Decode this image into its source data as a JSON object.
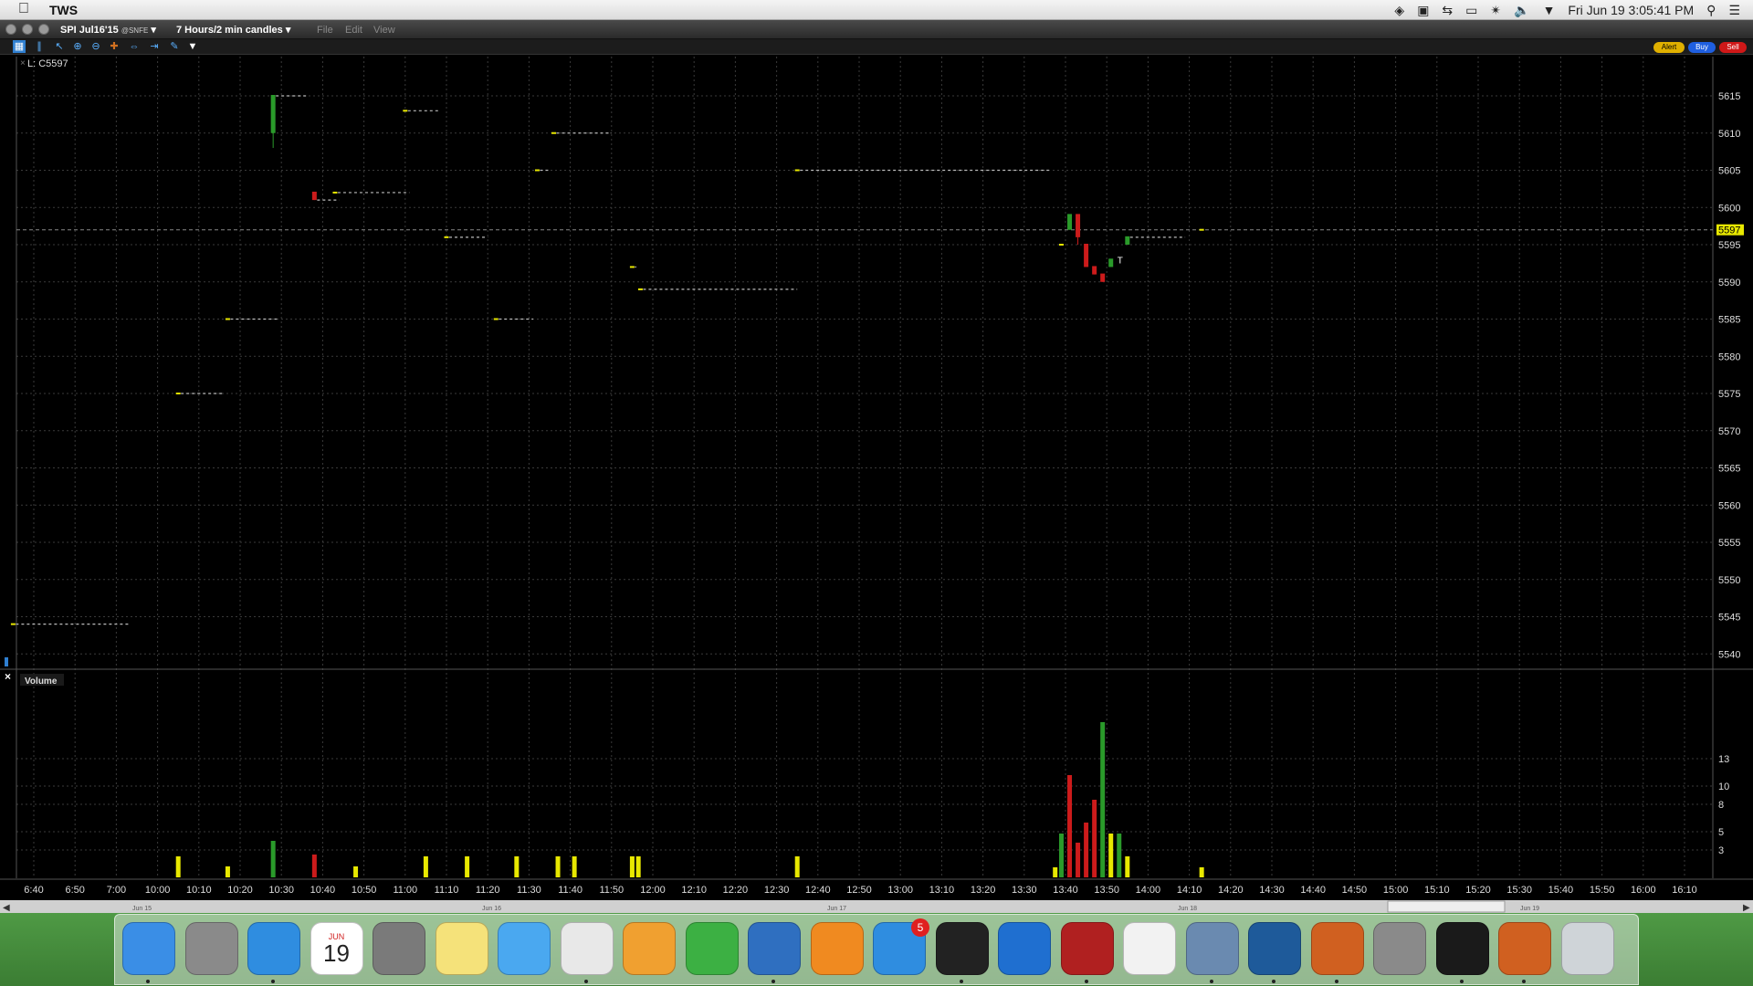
{
  "menubar": {
    "app_name": "TWS",
    "clock": "Fri Jun 19  3:05:41 PM",
    "tray_icons": [
      "dropbox-icon",
      "screenshot-icon",
      "teamviewer-icon",
      "airplay-icon",
      "bluetooth-icon",
      "volume-icon",
      "wifi-icon",
      "clock",
      "spotlight-icon",
      "notification-center-icon"
    ]
  },
  "window": {
    "symbol": "SPI Jul16'15",
    "exchange": "@SNFE",
    "period": "7 Hours/2 min candles",
    "menus": [
      "File",
      "Edit",
      "View"
    ],
    "buttons": {
      "alert": "Alert",
      "buy": "Buy",
      "sell": "Sell"
    }
  },
  "legend": {
    "price": "L: C5597",
    "volume": "Volume"
  },
  "colors": {
    "up": "#2a9a2a",
    "down": "#cc1b1b",
    "flat": "#e8e800",
    "grid": "#3a3a3a",
    "last_price_tag": "#e8e800"
  },
  "chart_data": {
    "type": "candlestick",
    "price_axis": {
      "ticks": [
        5615,
        5610,
        5605,
        5600,
        5595,
        5590,
        5585,
        5580,
        5575,
        5570,
        5565,
        5560,
        5555,
        5550,
        5545,
        5540
      ],
      "range": [
        5537.5,
        5617.5
      ]
    },
    "last_price": 5597,
    "time_axis": {
      "labels": [
        "6:40",
        "6:50",
        "7:00",
        "10:00",
        "10:10",
        "10:20",
        "10:30",
        "10:40",
        "10:50",
        "11:00",
        "11:10",
        "11:20",
        "11:30",
        "11:40",
        "11:50",
        "12:00",
        "12:10",
        "12:20",
        "12:30",
        "12:40",
        "12:50",
        "13:00",
        "13:10",
        "13:20",
        "13:30",
        "13:40",
        "13:50",
        "14:00",
        "14:10",
        "14:20",
        "14:30",
        "14:40",
        "14:50",
        "15:00",
        "15:10",
        "15:20",
        "15:30",
        "15:40",
        "15:50",
        "16:00",
        "16:10"
      ],
      "day_labels": [
        "Jun 15",
        "Jun 16",
        "Jun 17",
        "Jun 18",
        "Jun 19"
      ]
    },
    "volume_axis": {
      "ticks": [
        13,
        10,
        8,
        5,
        3
      ],
      "range": [
        0,
        17.5
      ]
    },
    "candles": [
      {
        "slot": -0.5,
        "open": 5544,
        "close": 5544,
        "high": 5544,
        "low": 5544,
        "dir": "flat",
        "dash_to": 2.3
      },
      {
        "slot": 3.5,
        "open": 5575,
        "close": 5575,
        "high": 5575,
        "low": 5575,
        "dir": "flat",
        "dash_to": 4.6
      },
      {
        "slot": 4.7,
        "open": 5585,
        "close": 5585,
        "high": 5585,
        "low": 5585,
        "dir": "flat",
        "dash_to": 5.9
      },
      {
        "slot": 5.8,
        "open": 5610,
        "close": 5615,
        "high": 5615,
        "low": 5608,
        "dir": "up",
        "dash_to": 6.6
      },
      {
        "slot": 6.8,
        "open": 5602,
        "close": 5601,
        "high": 5602,
        "low": 5601,
        "dir": "down",
        "dash_to": 7.4
      },
      {
        "slot": 7.3,
        "open": 5602,
        "close": 5602,
        "high": 5602,
        "low": 5602,
        "dir": "flat",
        "dash_to": 9.1
      },
      {
        "slot": 9.0,
        "open": 5613,
        "close": 5613,
        "high": 5613,
        "low": 5613,
        "dir": "flat",
        "dash_to": 9.8
      },
      {
        "slot": 10.0,
        "open": 5596,
        "close": 5596,
        "high": 5596,
        "low": 5596,
        "dir": "flat",
        "dash_to": 11.0
      },
      {
        "slot": 11.2,
        "open": 5585,
        "close": 5585,
        "high": 5585,
        "low": 5585,
        "dir": "flat",
        "dash_to": 12.1
      },
      {
        "slot": 12.2,
        "open": 5605,
        "close": 5605,
        "high": 5605,
        "low": 5605,
        "dir": "flat",
        "dash_to": 12.5
      },
      {
        "slot": 12.6,
        "open": 5610,
        "close": 5610,
        "high": 5610,
        "low": 5610,
        "dir": "flat",
        "dash_to": 14.0
      },
      {
        "slot": 14.5,
        "open": 5592,
        "close": 5592,
        "high": 5592,
        "low": 5592,
        "dir": "flat",
        "dash_to": 14.6
      },
      {
        "slot": 14.7,
        "open": 5589,
        "close": 5589,
        "high": 5589,
        "low": 5589,
        "dir": "flat",
        "dash_to": 18.5
      },
      {
        "slot": 18.5,
        "open": 5605,
        "close": 5605,
        "high": 5605,
        "low": 5605,
        "dir": "flat",
        "dash_to": 24.6
      },
      {
        "slot": 24.9,
        "open": 5595,
        "close": 5595,
        "high": 5595,
        "low": 5595,
        "dir": "flat"
      },
      {
        "slot": 25.1,
        "open": 5597,
        "close": 5599,
        "high": 5599,
        "low": 5597,
        "dir": "up"
      },
      {
        "slot": 25.3,
        "open": 5599,
        "close": 5596,
        "high": 5599,
        "low": 5595,
        "dir": "down"
      },
      {
        "slot": 25.5,
        "open": 5595,
        "close": 5592,
        "high": 5595,
        "low": 5592,
        "dir": "down"
      },
      {
        "slot": 25.7,
        "open": 5592,
        "close": 5591,
        "high": 5592,
        "low": 5591,
        "dir": "down"
      },
      {
        "slot": 25.9,
        "open": 5591,
        "close": 5590,
        "high": 5591,
        "low": 5590,
        "dir": "down"
      },
      {
        "slot": 26.1,
        "open": 5592,
        "close": 5593,
        "high": 5593,
        "low": 5592,
        "dir": "up"
      },
      {
        "slot": 26.5,
        "open": 5595,
        "close": 5596,
        "high": 5596,
        "low": 5595,
        "dir": "up",
        "dash_to": 27.9
      },
      {
        "slot": 28.3,
        "open": 5597,
        "close": 5597,
        "high": 5597,
        "low": 5597,
        "dir": "flat"
      }
    ],
    "trade_marker": {
      "slot": 26.3,
      "price": 5593,
      "label": "T"
    },
    "volume": [
      {
        "slot": 3.5,
        "v": 2.3,
        "dir": "flat"
      },
      {
        "slot": 4.7,
        "v": 1.2,
        "dir": "flat"
      },
      {
        "slot": 5.8,
        "v": 4.0,
        "dir": "up"
      },
      {
        "slot": 6.8,
        "v": 2.5,
        "dir": "down"
      },
      {
        "slot": 7.8,
        "v": 1.2,
        "dir": "flat"
      },
      {
        "slot": 9.5,
        "v": 2.3,
        "dir": "flat"
      },
      {
        "slot": 10.5,
        "v": 2.3,
        "dir": "flat"
      },
      {
        "slot": 11.7,
        "v": 2.3,
        "dir": "flat"
      },
      {
        "slot": 12.7,
        "v": 2.3,
        "dir": "flat"
      },
      {
        "slot": 13.1,
        "v": 2.3,
        "dir": "flat"
      },
      {
        "slot": 14.5,
        "v": 2.3,
        "dir": "flat"
      },
      {
        "slot": 14.65,
        "v": 2.3,
        "dir": "flat"
      },
      {
        "slot": 18.5,
        "v": 2.3,
        "dir": "flat"
      },
      {
        "slot": 24.75,
        "v": 1.1,
        "dir": "flat"
      },
      {
        "slot": 24.9,
        "v": 4.8,
        "dir": "up"
      },
      {
        "slot": 25.1,
        "v": 11.2,
        "dir": "down"
      },
      {
        "slot": 25.3,
        "v": 3.8,
        "dir": "down"
      },
      {
        "slot": 25.5,
        "v": 6.0,
        "dir": "down"
      },
      {
        "slot": 25.7,
        "v": 8.5,
        "dir": "down"
      },
      {
        "slot": 25.9,
        "v": 17.0,
        "dir": "up"
      },
      {
        "slot": 26.1,
        "v": 4.8,
        "dir": "flat"
      },
      {
        "slot": 26.3,
        "v": 4.8,
        "dir": "up"
      },
      {
        "slot": 26.5,
        "v": 2.3,
        "dir": "flat"
      },
      {
        "slot": 28.3,
        "v": 1.1,
        "dir": "flat"
      }
    ]
  },
  "dock": {
    "apps": [
      {
        "name": "finder-icon",
        "color": "#3a8ee6",
        "running": true
      },
      {
        "name": "launchpad-icon",
        "color": "#8a8a8a",
        "running": false
      },
      {
        "name": "safari-icon",
        "color": "#2f8de0",
        "running": true
      },
      {
        "name": "calendar-icon",
        "color": "#ffffff",
        "running": false,
        "text": "19",
        "subtext": "JUN"
      },
      {
        "name": "calculator-icon",
        "color": "#7a7a7a",
        "running": false
      },
      {
        "name": "notes-icon",
        "color": "#f5e27a",
        "running": false
      },
      {
        "name": "messages-icon",
        "color": "#4aa8f0",
        "running": false
      },
      {
        "name": "textedit-icon",
        "color": "#e8e8e8",
        "running": true
      },
      {
        "name": "pages-icon",
        "color": "#f0a030",
        "running": false
      },
      {
        "name": "numbers-icon",
        "color": "#3cb043",
        "running": false
      },
      {
        "name": "remote-desktop-icon",
        "color": "#2f6fc0",
        "running": true
      },
      {
        "name": "ibooks-icon",
        "color": "#f08a20",
        "running": false
      },
      {
        "name": "app-store-icon",
        "color": "#2f8de0",
        "running": false,
        "badge": "5"
      },
      {
        "name": "terminal-icon",
        "color": "#222222",
        "running": true
      },
      {
        "name": "teamviewer-icon",
        "color": "#1f6fd0",
        "running": false
      },
      {
        "name": "tws-icon",
        "color": "#b02020",
        "running": true
      },
      {
        "name": "java-icon",
        "color": "#f2f2f2",
        "running": false
      },
      {
        "name": "network-utility-icon",
        "color": "#6a8ab0",
        "running": true
      },
      {
        "name": "sourcetree-icon",
        "color": "#1e5a9a",
        "running": true
      },
      {
        "name": "matlab-icon",
        "color": "#d06020",
        "running": true
      },
      {
        "name": "system-preferences-icon",
        "color": "#8a8a8a",
        "running": false
      },
      {
        "name": "activity-monitor-icon",
        "color": "#1a1a1a",
        "running": true
      },
      {
        "name": "matlab-2-icon",
        "color": "#d06020",
        "running": true
      },
      {
        "name": "trash-icon",
        "color": "#cfd4d8",
        "running": false
      }
    ]
  }
}
